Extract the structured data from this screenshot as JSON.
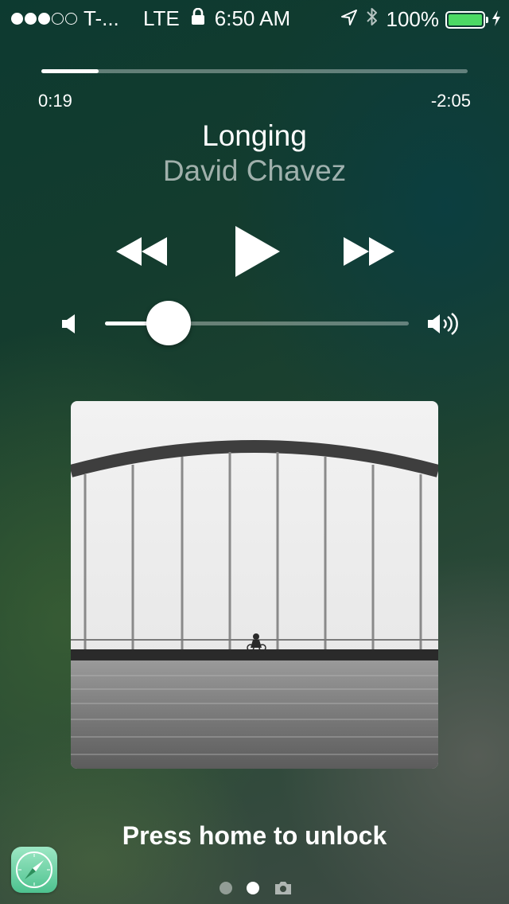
{
  "status_bar": {
    "carrier": "T-...",
    "network": "LTE",
    "time": "6:50 AM",
    "battery_percent": "100%",
    "signal_strength": 3,
    "signal_max": 5,
    "battery_level": 1.0,
    "battery_color": "#4cd964",
    "icons": [
      "lock-icon",
      "location-arrow-icon",
      "bluetooth-icon",
      "battery-icon",
      "charging-bolt-icon"
    ]
  },
  "now_playing": {
    "elapsed": "0:19",
    "remaining": "-2:05",
    "progress": 0.134,
    "title": "Longing",
    "artist": "David Chavez",
    "volume": 0.21,
    "controls": [
      "rewind-icon",
      "play-icon",
      "fast-forward-icon"
    ]
  },
  "lock_screen": {
    "unlock_prompt": "Press home to unlock",
    "pages": 2,
    "active_page": 2,
    "shortcut_app": "safari-icon"
  }
}
